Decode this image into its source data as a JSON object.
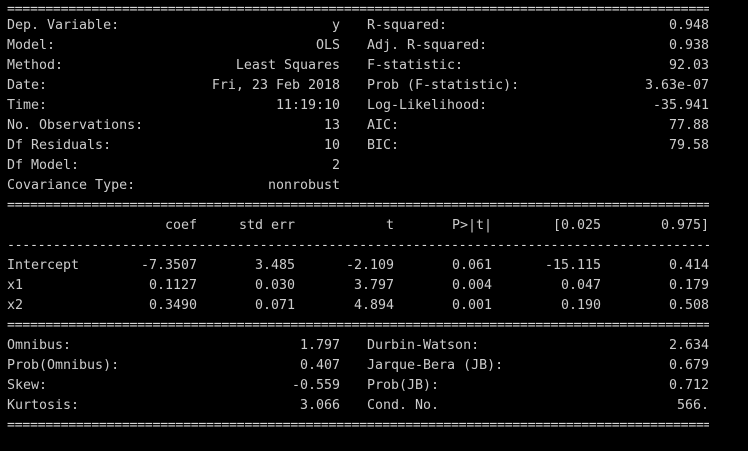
{
  "summary": {
    "top": {
      "left": [
        {
          "key": "Dep. Variable:",
          "value": "y"
        },
        {
          "key": "Model:",
          "value": "OLS"
        },
        {
          "key": "Method:",
          "value": "Least Squares"
        },
        {
          "key": "Date:",
          "value": "Fri, 23 Feb 2018"
        },
        {
          "key": "Time:",
          "value": "11:19:10"
        },
        {
          "key": "No. Observations:",
          "value": "13"
        },
        {
          "key": "Df Residuals:",
          "value": "10"
        },
        {
          "key": "Df Model:",
          "value": "2"
        },
        {
          "key": "Covariance Type:",
          "value": "nonrobust"
        }
      ],
      "right": [
        {
          "key": "R-squared:",
          "value": "0.948"
        },
        {
          "key": "Adj. R-squared:",
          "value": "0.938"
        },
        {
          "key": "F-statistic:",
          "value": "92.03"
        },
        {
          "key": "Prob (F-statistic):",
          "value": "3.63e-07"
        },
        {
          "key": "Log-Likelihood:",
          "value": "-35.941"
        },
        {
          "key": "AIC:",
          "value": "77.88"
        },
        {
          "key": "BIC:",
          "value": "79.58"
        }
      ]
    },
    "coef_table": {
      "headers": [
        "coef",
        "std err",
        "t",
        "P>|t|",
        "[0.025",
        "0.975]"
      ],
      "rows": [
        {
          "name": "Intercept",
          "values": [
            "-7.3507",
            "3.485",
            "-2.109",
            "0.061",
            "-15.115",
            "0.414"
          ]
        },
        {
          "name": "x1",
          "values": [
            "0.1127",
            "0.030",
            "3.797",
            "0.004",
            "0.047",
            "0.179"
          ]
        },
        {
          "name": "x2",
          "values": [
            "0.3490",
            "0.071",
            "4.894",
            "0.001",
            "0.190",
            "0.508"
          ]
        }
      ]
    },
    "diagnostics": {
      "left": [
        {
          "key": "Omnibus:",
          "value": "1.797"
        },
        {
          "key": "Prob(Omnibus):",
          "value": "0.407"
        },
        {
          "key": "Skew:",
          "value": "-0.559"
        },
        {
          "key": "Kurtosis:",
          "value": "3.066"
        }
      ],
      "right": [
        {
          "key": "Durbin-Watson:",
          "value": "2.634"
        },
        {
          "key": "Jarque-Bera (JB):",
          "value": "0.679"
        },
        {
          "key": "Prob(JB):",
          "value": "0.712"
        },
        {
          "key": "Cond. No.",
          "value": "566."
        }
      ]
    }
  },
  "theme": {
    "background": "#000000",
    "text": "#cccccc"
  }
}
